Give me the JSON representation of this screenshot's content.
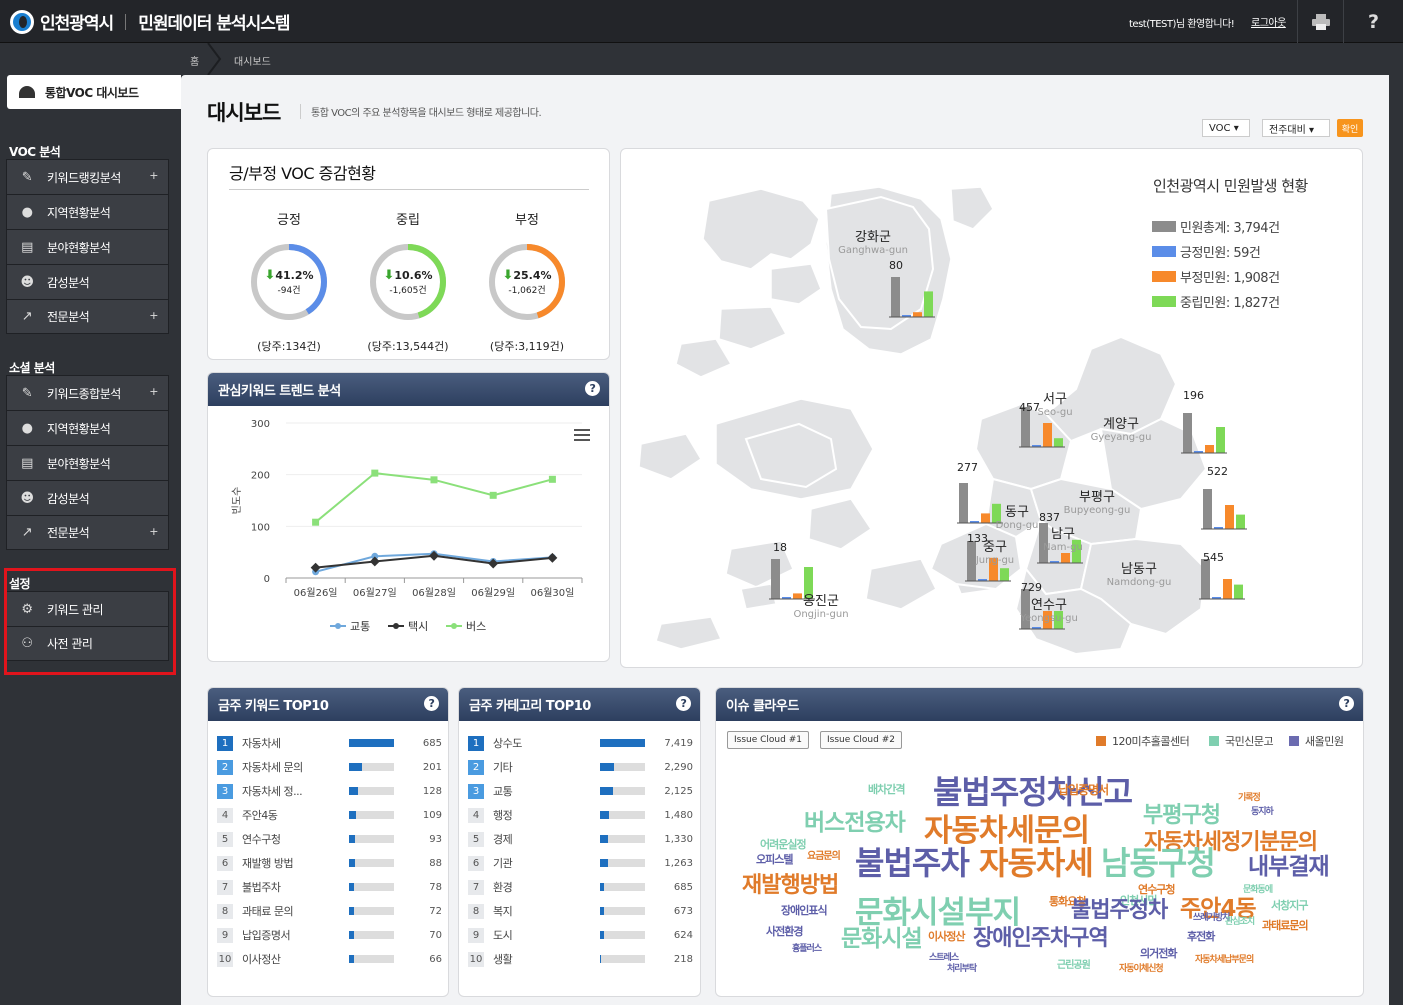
{
  "header": {
    "org_name": "인천광역시",
    "system_name": "민원데이터 분석시스템",
    "welcome": "test(TEST)님 환영합니다!",
    "logout": "로그아웃",
    "print_icon": "printer-icon",
    "help_icon": "question-icon"
  },
  "breadcrumb": {
    "home": "홈",
    "current": "대시보드"
  },
  "sidebar": {
    "dashboard": "통합VOC 대시보드",
    "sections": [
      {
        "title": "VOC 분석",
        "items": [
          {
            "label": "키워드랭킹분석",
            "icon": "pen-icon",
            "plus": "+"
          },
          {
            "label": "지역현황분석",
            "icon": "map-pin-icon",
            "plus": ""
          },
          {
            "label": "분야현황분석",
            "icon": "document-icon",
            "plus": ""
          },
          {
            "label": "감성분석",
            "icon": "smiley-icon",
            "plus": ""
          },
          {
            "label": "전문분석",
            "icon": "trend-chart-icon",
            "plus": "+"
          }
        ]
      },
      {
        "title": "소셜 분석",
        "items": [
          {
            "label": "키워드종합분석",
            "icon": "pen-icon",
            "plus": "+"
          },
          {
            "label": "지역현황분석",
            "icon": "map-pin-icon",
            "plus": ""
          },
          {
            "label": "분야현황분석",
            "icon": "document-icon",
            "plus": ""
          },
          {
            "label": "감성분석",
            "icon": "smiley-icon",
            "plus": ""
          },
          {
            "label": "전문분석",
            "icon": "trend-chart-icon",
            "plus": "+"
          }
        ]
      },
      {
        "title": "설정",
        "items": [
          {
            "label": "키워드 관리",
            "icon": "gear-icon",
            "plus": ""
          },
          {
            "label": "사전 관리",
            "icon": "users-icon",
            "plus": ""
          }
        ]
      }
    ]
  },
  "page": {
    "title": "대시보드",
    "description": "통합 VOC의 주요 분석항목을 대시보드 형태로 제공합니다.",
    "filter_source": "VOC ▾",
    "filter_period": "전주대비 ▾",
    "confirm": "확인"
  },
  "voc_panel": {
    "title": "긍/부정 VOC 증감현황",
    "gauges": [
      {
        "name": "긍정",
        "percent": "41.2%",
        "change": "-94건",
        "base": "(당주:134건)",
        "fill": 0.412,
        "color": "#5b8de8"
      },
      {
        "name": "중립",
        "percent": "10.6%",
        "change": "-1,605건",
        "base": "(당주:13,544건)",
        "fill": 0.45,
        "color": "#7ed957"
      },
      {
        "name": "부정",
        "percent": "25.4%",
        "change": "-1,062건",
        "base": "(당주:3,119건)",
        "fill": 0.45,
        "color": "#f7892b"
      }
    ]
  },
  "trend_panel": {
    "title": "관심키워드 트렌드 분석",
    "help": "?",
    "chart_data": {
      "type": "line",
      "categories": [
        "06월26일",
        "06월27일",
        "06월28일",
        "06월29일",
        "06월30일"
      ],
      "ylabel": "빈도수",
      "ylim": [
        0,
        300
      ],
      "yticks": [
        "0",
        "100",
        "200",
        "300"
      ],
      "series": [
        {
          "name": "교통",
          "color": "#6fa8dc",
          "values": [
            12,
            42,
            47,
            32,
            40
          ]
        },
        {
          "name": "택시",
          "color": "#333333",
          "values": [
            20,
            32,
            43,
            28,
            39
          ]
        },
        {
          "name": "버스",
          "color": "#8be07a",
          "values": [
            108,
            203,
            190,
            160,
            191
          ]
        }
      ]
    }
  },
  "map_panel": {
    "title": "인천광역시 민원발생 현황",
    "legend": [
      {
        "label": "민원총계: 3,794건",
        "color": "#8c8c8c"
      },
      {
        "label": "긍정민원: 59건",
        "color": "#5b8de8"
      },
      {
        "label": "부정민원: 1,908건",
        "color": "#f7892b"
      },
      {
        "label": "중립민원: 1,827건",
        "color": "#7ed957"
      }
    ],
    "districts": [
      {
        "kr": "강화군",
        "en": "Ganghwa-gun",
        "total": "80",
        "bars": [
          1,
          0.02,
          0.12,
          0.64
        ]
      },
      {
        "kr": "서구",
        "en": "Seo-gu",
        "total": "457",
        "bars": [
          1,
          0.02,
          0.6,
          0.22
        ]
      },
      {
        "kr": "계양구",
        "en": "Gyeyang-gu",
        "total": "196",
        "bars": [
          1,
          0.02,
          0.2,
          0.65
        ]
      },
      {
        "kr": "동구",
        "en": "Dong-gu",
        "total": "277",
        "bars": [
          1,
          0.02,
          0.24,
          0.48
        ]
      },
      {
        "kr": "부평구",
        "en": "Bupyeong-gu",
        "total": "522",
        "bars": [
          1,
          0.02,
          0.6,
          0.36
        ]
      },
      {
        "kr": "중구",
        "en": "Jung-gu",
        "total": "133",
        "bars": [
          1,
          0.02,
          0.58,
          0.32
        ]
      },
      {
        "kr": "남구",
        "en": "Nam-gu",
        "total": "837",
        "bars": [
          1,
          0.02,
          0.25,
          0.58
        ]
      },
      {
        "kr": "옹진군",
        "en": "Ongjin-gun",
        "total": "18",
        "bars": [
          1,
          0.02,
          0.14,
          0.8
        ]
      },
      {
        "kr": "남동구",
        "en": "Namdong-gu",
        "total": "545",
        "bars": [
          1,
          0.02,
          0.5,
          0.36
        ]
      },
      {
        "kr": "연수구",
        "en": "Yeongsu-gu",
        "total": "729",
        "bars": [
          1,
          0.02,
          0.45,
          0.45
        ]
      }
    ]
  },
  "keyword_panel": {
    "title": "금주 키워드 TOP10",
    "help": "?",
    "items": [
      {
        "rank": "1",
        "label": "자동차세",
        "value": "685",
        "ratio": 1.0
      },
      {
        "rank": "2",
        "label": "자동차세 문의",
        "value": "201",
        "ratio": 0.29
      },
      {
        "rank": "3",
        "label": "자동차세 정...",
        "value": "128",
        "ratio": 0.19
      },
      {
        "rank": "4",
        "label": "주안4동",
        "value": "109",
        "ratio": 0.16
      },
      {
        "rank": "5",
        "label": "연수구청",
        "value": "93",
        "ratio": 0.14
      },
      {
        "rank": "6",
        "label": "재발행 방법",
        "value": "88",
        "ratio": 0.13
      },
      {
        "rank": "7",
        "label": "불법주차",
        "value": "78",
        "ratio": 0.11
      },
      {
        "rank": "8",
        "label": "과태료 문의",
        "value": "72",
        "ratio": 0.1
      },
      {
        "rank": "9",
        "label": "납입증명서",
        "value": "70",
        "ratio": 0.1
      },
      {
        "rank": "10",
        "label": "이사정산",
        "value": "66",
        "ratio": 0.1
      }
    ]
  },
  "category_panel": {
    "title": "금주 카테고리 TOP10",
    "help": "?",
    "items": [
      {
        "rank": "1",
        "label": "상수도",
        "value": "7,419",
        "ratio": 1.0
      },
      {
        "rank": "2",
        "label": "기타",
        "value": "2,290",
        "ratio": 0.31
      },
      {
        "rank": "3",
        "label": "교통",
        "value": "2,125",
        "ratio": 0.29
      },
      {
        "rank": "4",
        "label": "행정",
        "value": "1,480",
        "ratio": 0.2
      },
      {
        "rank": "5",
        "label": "경제",
        "value": "1,330",
        "ratio": 0.18
      },
      {
        "rank": "6",
        "label": "기관",
        "value": "1,263",
        "ratio": 0.17
      },
      {
        "rank": "7",
        "label": "환경",
        "value": "685",
        "ratio": 0.09
      },
      {
        "rank": "8",
        "label": "복지",
        "value": "673",
        "ratio": 0.09
      },
      {
        "rank": "9",
        "label": "도시",
        "value": "624",
        "ratio": 0.08
      },
      {
        "rank": "10",
        "label": "생활",
        "value": "218",
        "ratio": 0.03
      }
    ]
  },
  "cloud_panel": {
    "title": "이슈 클라우드",
    "help": "?",
    "tab1": "Issue Cloud #1",
    "tab2": "Issue Cloud #2",
    "legend": [
      {
        "label": "120미추홀콜센터",
        "color": "#e07b2a"
      },
      {
        "label": "국민신문고",
        "color": "#7fcfb0"
      },
      {
        "label": "새올민원",
        "color": "#6b6bb0"
      }
    ],
    "words": [
      {
        "text": "불법주정차신고",
        "color": "#5d5ea8",
        "size": 32
      },
      {
        "text": "배차간격",
        "color": "#7fcfb0",
        "size": 11
      },
      {
        "text": "납입증명서",
        "color": "#e07b2a",
        "size": 12
      },
      {
        "text": "기록정",
        "color": "#e07b2a",
        "size": 9
      },
      {
        "text": "부평구청",
        "color": "#7fcfb0",
        "size": 22
      },
      {
        "text": "동지하",
        "color": "#5d5ea8",
        "size": 9
      },
      {
        "text": "버스전용차",
        "color": "#7fcfb0",
        "size": 23
      },
      {
        "text": "자동차세문의",
        "color": "#e07b2a",
        "size": 31
      },
      {
        "text": "자동차세정기분문의",
        "color": "#e07b2a",
        "size": 22
      },
      {
        "text": "어려운실정",
        "color": "#7fcfb0",
        "size": 11
      },
      {
        "text": "오피스텔",
        "color": "#5d5ea8",
        "size": 11
      },
      {
        "text": "요금문의",
        "color": "#e07b2a",
        "size": 10
      },
      {
        "text": "불법주차",
        "color": "#5d5ea8",
        "size": 32
      },
      {
        "text": "자동차세",
        "color": "#e07b2a",
        "size": 32
      },
      {
        "text": "남동구청",
        "color": "#7fcfb0",
        "size": 32
      },
      {
        "text": "내부결재",
        "color": "#5d5ea8",
        "size": 23
      },
      {
        "text": "재발행방법",
        "color": "#e07b2a",
        "size": 22
      },
      {
        "text": "연수구청",
        "color": "#e07b2a",
        "size": 11
      },
      {
        "text": "문화동에",
        "color": "#7fcfb0",
        "size": 9
      },
      {
        "text": "통화요청",
        "color": "#e07b2a",
        "size": 11
      },
      {
        "text": "인천시민",
        "color": "#7fcfb0",
        "size": 11
      },
      {
        "text": "장애인표식",
        "color": "#5d5ea8",
        "size": 11
      },
      {
        "text": "문화시설부지",
        "color": "#7fcfb0",
        "size": 31
      },
      {
        "text": "불법주정차",
        "color": "#5d5ea8",
        "size": 22
      },
      {
        "text": "주안4동",
        "color": "#e07b2a",
        "size": 23
      },
      {
        "text": "서창지구",
        "color": "#7fcfb0",
        "size": 11
      },
      {
        "text": "쓰레기방치",
        "color": "#5d5ea8",
        "size": 9
      },
      {
        "text": "관심조치",
        "color": "#7fcfb0",
        "size": 9
      },
      {
        "text": "과태료문의",
        "color": "#e07b2a",
        "size": 11
      },
      {
        "text": "사전환경",
        "color": "#5d5ea8",
        "size": 11
      },
      {
        "text": "이사정산",
        "color": "#e07b2a",
        "size": 11
      },
      {
        "text": "후전화",
        "color": "#5d5ea8",
        "size": 11
      },
      {
        "text": "문화시설",
        "color": "#7fcfb0",
        "size": 23
      },
      {
        "text": "장애인주차구역",
        "color": "#5d5ea8",
        "size": 22
      },
      {
        "text": "의거전화",
        "color": "#5d5ea8",
        "size": 11
      },
      {
        "text": "흉플러스",
        "color": "#5d5ea8",
        "size": 9
      },
      {
        "text": "스트레스",
        "color": "#5d5ea8",
        "size": 9
      },
      {
        "text": "자동차세납부문의",
        "color": "#e07b2a",
        "size": 9
      },
      {
        "text": "근린공원",
        "color": "#7fcfb0",
        "size": 10
      },
      {
        "text": "처리부탁",
        "color": "#5d5ea8",
        "size": 9
      },
      {
        "text": "자동이체신청",
        "color": "#e07b2a",
        "size": 9
      }
    ]
  }
}
